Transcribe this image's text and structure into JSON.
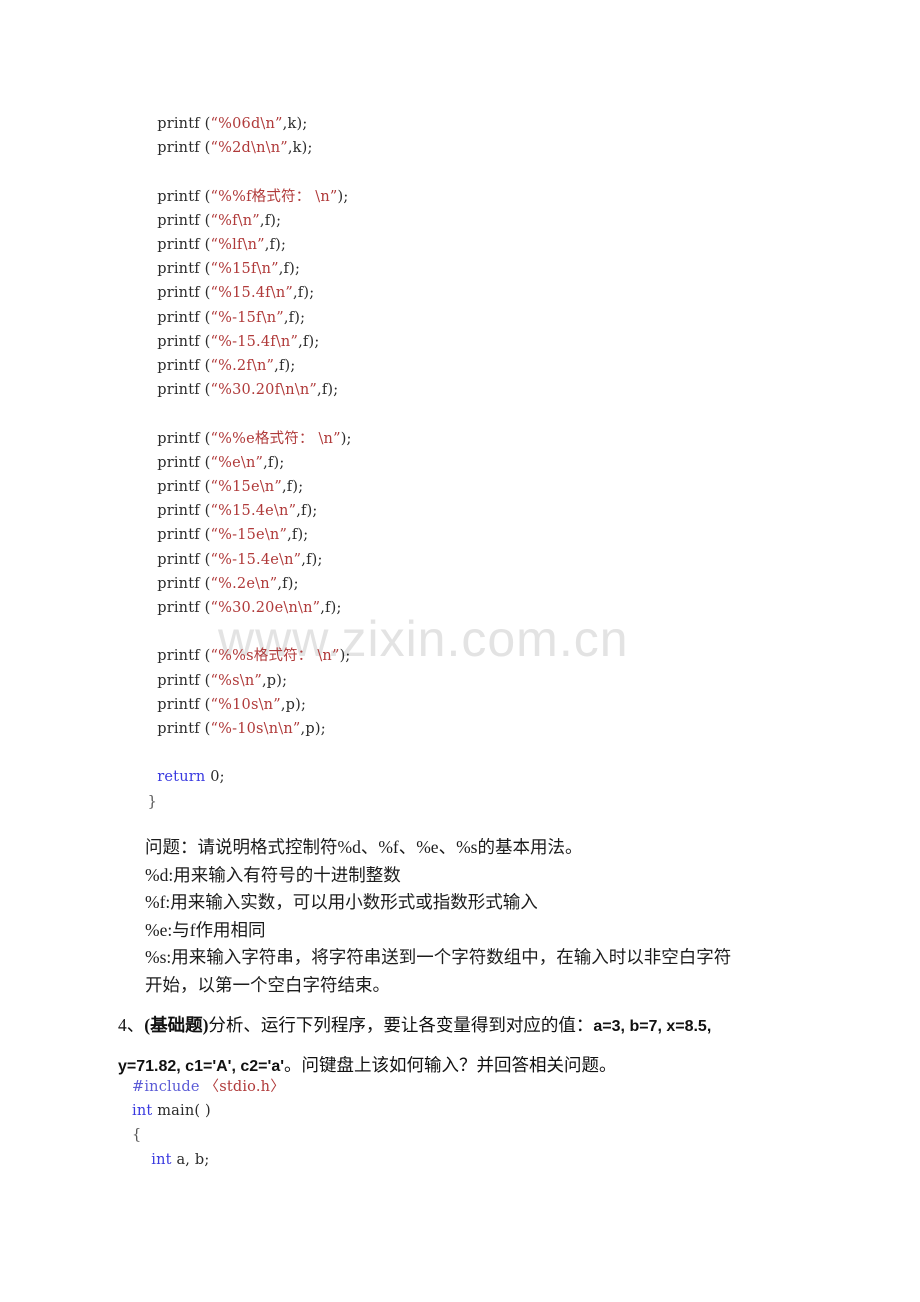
{
  "document": {
    "watermark": "www.zixin.com.cn",
    "code_top": {
      "lines": [
        [
          {
            "t": "plain",
            "s": "    printf ("
          },
          {
            "t": "str",
            "s": "“%06d\\n”"
          },
          {
            "t": "plain",
            "s": ",k);"
          }
        ],
        [
          {
            "t": "plain",
            "s": "    printf ("
          },
          {
            "t": "str",
            "s": "“%2d\\n\\n”"
          },
          {
            "t": "plain",
            "s": ",k);"
          }
        ],
        [],
        [
          {
            "t": "plain",
            "s": "    printf ("
          },
          {
            "t": "str",
            "s": "“%%f格式符： \\n”"
          },
          {
            "t": "plain",
            "s": ");"
          }
        ],
        [
          {
            "t": "plain",
            "s": "    printf ("
          },
          {
            "t": "str",
            "s": "“%f\\n”"
          },
          {
            "t": "plain",
            "s": ",f);"
          }
        ],
        [
          {
            "t": "plain",
            "s": "    printf ("
          },
          {
            "t": "str",
            "s": "“%lf\\n”"
          },
          {
            "t": "plain",
            "s": ",f);"
          }
        ],
        [
          {
            "t": "plain",
            "s": "    printf ("
          },
          {
            "t": "str",
            "s": "“%15f\\n”"
          },
          {
            "t": "plain",
            "s": ",f);"
          }
        ],
        [
          {
            "t": "plain",
            "s": "    printf ("
          },
          {
            "t": "str",
            "s": "“%15.4f\\n”"
          },
          {
            "t": "plain",
            "s": ",f);"
          }
        ],
        [
          {
            "t": "plain",
            "s": "    printf ("
          },
          {
            "t": "str",
            "s": "“%-15f\\n”"
          },
          {
            "t": "plain",
            "s": ",f);"
          }
        ],
        [
          {
            "t": "plain",
            "s": "    printf ("
          },
          {
            "t": "str",
            "s": "“%-15.4f\\n”"
          },
          {
            "t": "plain",
            "s": ",f);"
          }
        ],
        [
          {
            "t": "plain",
            "s": "    printf ("
          },
          {
            "t": "str",
            "s": "“%.2f\\n”"
          },
          {
            "t": "plain",
            "s": ",f);"
          }
        ],
        [
          {
            "t": "plain",
            "s": "    printf ("
          },
          {
            "t": "str",
            "s": "“%30.20f\\n\\n”"
          },
          {
            "t": "plain",
            "s": ",f);"
          }
        ],
        [],
        [
          {
            "t": "plain",
            "s": "    printf ("
          },
          {
            "t": "str",
            "s": "“%%e格式符： \\n”"
          },
          {
            "t": "plain",
            "s": ");"
          }
        ],
        [
          {
            "t": "plain",
            "s": "    printf ("
          },
          {
            "t": "str",
            "s": "“%e\\n”"
          },
          {
            "t": "plain",
            "s": ",f);"
          }
        ],
        [
          {
            "t": "plain",
            "s": "    printf ("
          },
          {
            "t": "str",
            "s": "“%15e\\n”"
          },
          {
            "t": "plain",
            "s": ",f);"
          }
        ],
        [
          {
            "t": "plain",
            "s": "    printf ("
          },
          {
            "t": "str",
            "s": "“%15.4e\\n”"
          },
          {
            "t": "plain",
            "s": ",f);"
          }
        ],
        [
          {
            "t": "plain",
            "s": "    printf ("
          },
          {
            "t": "str",
            "s": "“%-15e\\n”"
          },
          {
            "t": "plain",
            "s": ",f);"
          }
        ],
        [
          {
            "t": "plain",
            "s": "    printf ("
          },
          {
            "t": "str",
            "s": "“%-15.4e\\n”"
          },
          {
            "t": "plain",
            "s": ",f);"
          }
        ],
        [
          {
            "t": "plain",
            "s": "    printf ("
          },
          {
            "t": "str",
            "s": "“%.2e\\n”"
          },
          {
            "t": "plain",
            "s": ",f);"
          }
        ],
        [
          {
            "t": "plain",
            "s": "    printf ("
          },
          {
            "t": "str",
            "s": "“%30.20e\\n\\n”"
          },
          {
            "t": "plain",
            "s": ",f);"
          }
        ],
        [],
        [
          {
            "t": "plain",
            "s": "    printf ("
          },
          {
            "t": "str",
            "s": "“%%s格式符： \\n”"
          },
          {
            "t": "plain",
            "s": ");"
          }
        ],
        [
          {
            "t": "plain",
            "s": "    printf ("
          },
          {
            "t": "str",
            "s": "“%s\\n”"
          },
          {
            "t": "plain",
            "s": ",p);"
          }
        ],
        [
          {
            "t": "plain",
            "s": "    printf ("
          },
          {
            "t": "str",
            "s": "“%10s\\n”"
          },
          {
            "t": "plain",
            "s": ",p);"
          }
        ],
        [
          {
            "t": "plain",
            "s": "    printf ("
          },
          {
            "t": "str",
            "s": "“%-10s\\n\\n”"
          },
          {
            "t": "plain",
            "s": ",p);"
          }
        ],
        [],
        [
          {
            "t": "plain",
            "s": "    "
          },
          {
            "t": "kw",
            "s": "return"
          },
          {
            "t": "plain",
            "s": " 0;"
          }
        ],
        [
          {
            "t": "brace",
            "s": "  }"
          }
        ]
      ]
    },
    "explanation": {
      "lines": [
        "问题：请说明格式控制符%d、%f、%e、%s的基本用法。",
        "%d:用来输入有符号的十进制整数",
        "%f:用来输入实数，可以用小数形式或指数形式输入",
        "%e:与f作用相同",
        "%s:用来输入字符串，将字符串送到一个字符数组中，在输入时以非空白字符",
        "开始，以第一个空白字符结束。"
      ]
    },
    "question4": {
      "number": "4、",
      "tag": "(基础题)",
      "line1_rest": "分析、运行下列程序，要让各变量得到对应的值：",
      "line1_values": "a=3, b=7, x=8.5,",
      "line2_values": "y=71.82, c1='A', c2='a'",
      "line2_rest": "。问键盘上该如何输入？并回答相关问题。"
    },
    "code_bottom": {
      "lines": [
        [
          {
            "t": "pre",
            "s": "#include "
          },
          {
            "t": "str",
            "s": "〈stdio.h〉"
          }
        ],
        [
          {
            "t": "kw",
            "s": "int"
          },
          {
            "t": "plain",
            "s": " main( )"
          }
        ],
        [
          {
            "t": "brace",
            "s": "{"
          }
        ],
        [
          {
            "t": "plain",
            "s": "    "
          },
          {
            "t": "kw",
            "s": "int"
          },
          {
            "t": "plain",
            "s": " a, b;"
          }
        ]
      ]
    },
    "colors": {
      "string_literal": "#b03a3a",
      "keyword": "#3a3ae0",
      "preprocessor": "#5b5bd6",
      "plain_code": "#2b2b2b",
      "brace": "#555555",
      "body_text": "#1c1c1c",
      "watermark": "#e3e3e3",
      "page_background": "#ffffff"
    }
  }
}
